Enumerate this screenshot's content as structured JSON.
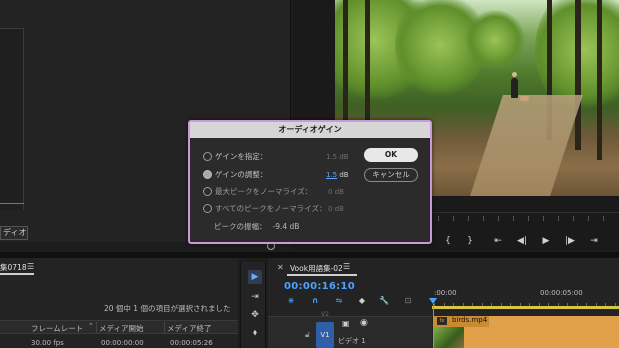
{
  "left_panel": {
    "tab_label": "ディオ"
  },
  "program_monitor": {
    "transport_icons": [
      "mark-in-icon",
      "mark-out-icon",
      "go-to-in-icon",
      "step-back-icon",
      "play-icon",
      "step-forward-icon",
      "go-to-out-icon"
    ],
    "transport_glyphs": [
      "{",
      "}",
      "⇤",
      "◀|",
      "▶",
      "|▶",
      "⇥"
    ]
  },
  "dialog": {
    "title": "オーディオゲイン",
    "options": [
      {
        "label": "ゲインを指定：",
        "value": "1.5 dB",
        "checked": false
      },
      {
        "label": "ゲインの調整：",
        "value_num": "1.5",
        "value_unit": " dB",
        "checked": true
      },
      {
        "label": "最大ピークをノーマライズ：",
        "value": "0 dB",
        "checked": false
      },
      {
        "label": "すべてのピークをノーマライズ：",
        "value": "0 dB",
        "checked": false
      }
    ],
    "peak_label": "ピークの振幅：",
    "peak_value": "-9.4 dB",
    "ok_label": "OK",
    "cancel_label": "キャンセル"
  },
  "project": {
    "tab_label": "集0718",
    "menu_glyph": "☰",
    "selection_status": "20 個中 1 個の項目が選択されました",
    "columns": [
      "フレームレート",
      "メディア開始",
      "メディア終了"
    ],
    "row": [
      "30.00 fps",
      "00:00:00:00",
      "00:00:05:26"
    ]
  },
  "tools": {
    "glyphs": [
      "▶",
      "⇥",
      "✥",
      "⬧"
    ]
  },
  "timeline": {
    "close_glyph": "✕",
    "tab_label": "Vook用語集-02",
    "menu_glyph": "☰",
    "timecode": "00:00:16:10",
    "ruler_times": [
      ":00:00",
      "00:00:05:00"
    ],
    "tool_glyphs": [
      "⋇",
      "∩",
      "⇋",
      "◆",
      "🔧",
      "⊡"
    ],
    "track_v2": "V2",
    "track_v1": "V1",
    "track_name": "ビデオ 1",
    "clip_fx": "fx",
    "clip_name": "birds.mp4",
    "colors": {
      "accent": "#4aa3ff",
      "clip": "#e0a14a",
      "work_area": "#d6c642",
      "dialog_border": "#c89ad9"
    }
  }
}
